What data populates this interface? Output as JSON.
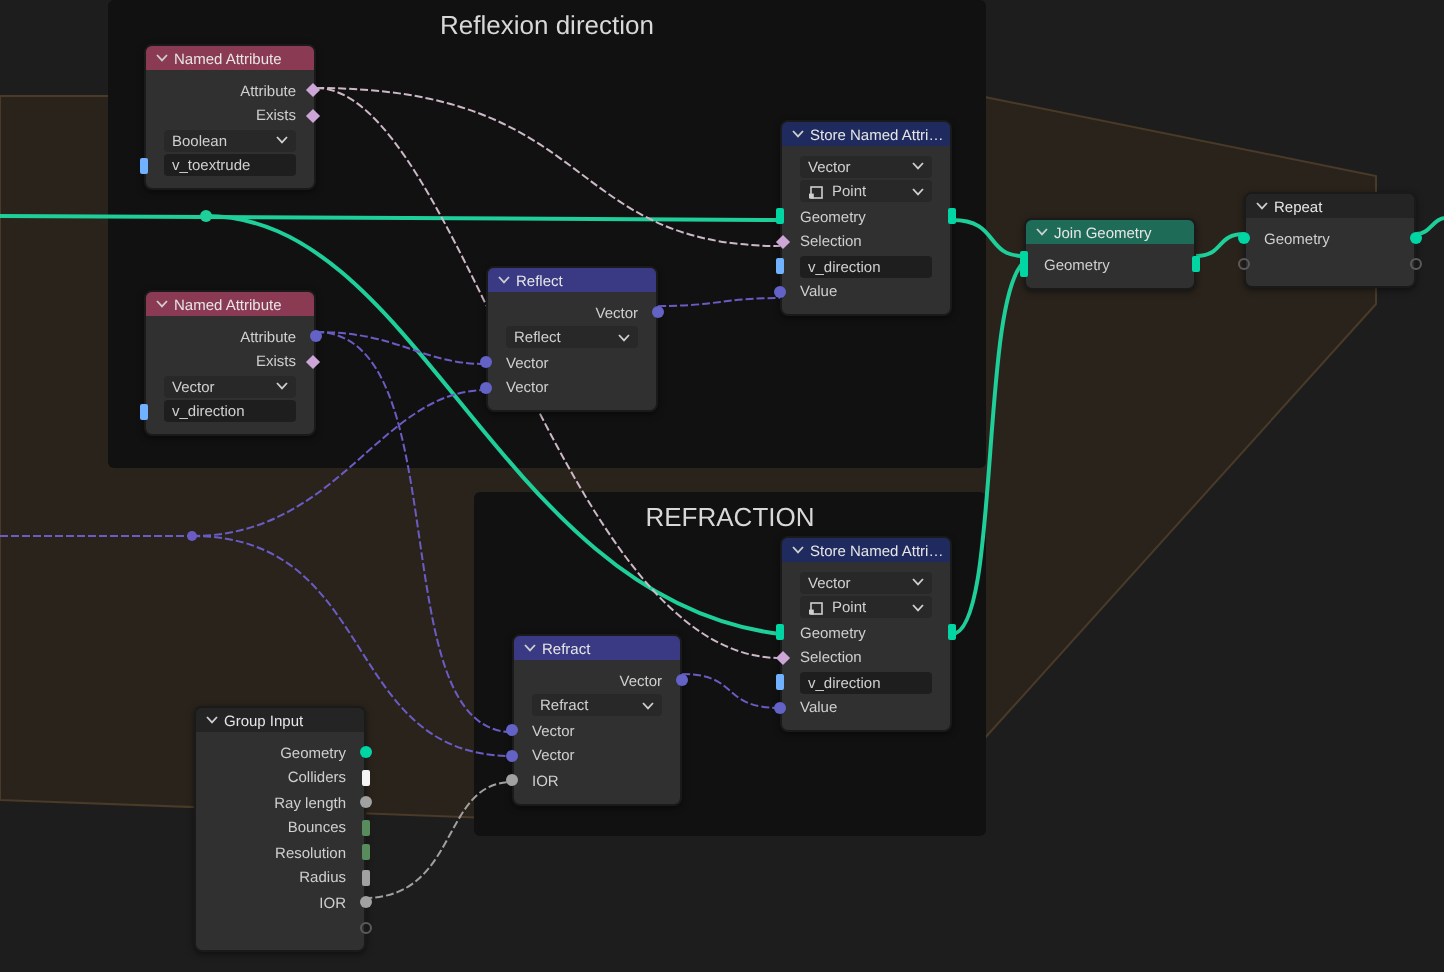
{
  "frames": [
    {
      "label": "Reflexion direction"
    },
    {
      "label": "REFRACTION"
    }
  ],
  "nodes": [
    {
      "title": "Named Attribute",
      "color": "#8b3a53",
      "rows": [
        {
          "kind": "socket",
          "label": "Attribute",
          "out": {
            "kind": "boolean"
          }
        },
        {
          "kind": "socket",
          "label": "Exists",
          "out": {
            "kind": "boolean"
          }
        },
        {
          "kind": "menu",
          "label": "Boolean"
        },
        {
          "kind": "field",
          "value": "v_toextrude",
          "in": {
            "kind": "string"
          }
        }
      ]
    },
    {
      "title": "Store Named Attri…",
      "color": "#1f2a5e",
      "rows": [
        {
          "kind": "menu",
          "label": "Vector"
        },
        {
          "kind": "menu_icon",
          "label": "Point"
        },
        {
          "kind": "socket",
          "label": "Geometry",
          "in": {
            "kind": "geometry"
          },
          "out": {
            "kind": "geometry"
          }
        },
        {
          "kind": "socket",
          "label": "Selection",
          "in": {
            "kind": "boolean"
          }
        },
        {
          "kind": "field",
          "value": "v_direction",
          "in": {
            "kind": "string"
          }
        },
        {
          "kind": "socket",
          "label": "Value",
          "in": {
            "kind": "vector"
          }
        }
      ]
    },
    {
      "title": "Repeat",
      "color": "#242424",
      "rows": [
        {
          "kind": "socket",
          "label": "Geometry",
          "in": {
            "kind": "geometry_dot"
          },
          "out": {
            "kind": "geometry_dot"
          }
        },
        {
          "kind": "socket",
          "in": {
            "kind": "virtual"
          },
          "out": {
            "kind": "virtual"
          }
        }
      ]
    },
    {
      "title": "Join Geometry",
      "color": "#1e6b58",
      "rows": [
        {
          "kind": "socket",
          "label": "Geometry",
          "in": {
            "kind": "geometry_multi"
          },
          "out": {
            "kind": "geometry"
          }
        }
      ]
    },
    {
      "title": "Reflect",
      "color": "#3a3a84",
      "rows": [
        {
          "kind": "socket",
          "label": "Vector",
          "out": {
            "kind": "vector"
          }
        },
        {
          "kind": "menu",
          "label": "Reflect"
        },
        {
          "kind": "socket",
          "label": "Vector",
          "in": {
            "kind": "vector"
          }
        },
        {
          "kind": "socket",
          "label": "Vector",
          "in": {
            "kind": "vector"
          }
        }
      ]
    },
    {
      "title": "Named Attribute",
      "color": "#8b3a53",
      "rows": [
        {
          "kind": "socket",
          "label": "Attribute",
          "out": {
            "kind": "vector"
          }
        },
        {
          "kind": "socket",
          "label": "Exists",
          "out": {
            "kind": "boolean"
          }
        },
        {
          "kind": "menu",
          "label": "Vector"
        },
        {
          "kind": "field",
          "value": "v_direction",
          "in": {
            "kind": "string"
          }
        }
      ]
    },
    {
      "title": "Store Named Attri…",
      "color": "#1f2a5e",
      "rows": [
        {
          "kind": "menu",
          "label": "Vector"
        },
        {
          "kind": "menu_icon",
          "label": "Point"
        },
        {
          "kind": "socket",
          "label": "Geometry",
          "in": {
            "kind": "geometry"
          },
          "out": {
            "kind": "geometry"
          }
        },
        {
          "kind": "socket",
          "label": "Selection",
          "in": {
            "kind": "boolean"
          }
        },
        {
          "kind": "field",
          "value": "v_direction",
          "in": {
            "kind": "string"
          }
        },
        {
          "kind": "socket",
          "label": "Value",
          "in": {
            "kind": "vector"
          }
        }
      ]
    },
    {
      "title": "Refract",
      "color": "#3a3a84",
      "rows": [
        {
          "kind": "socket",
          "label": "Vector",
          "out": {
            "kind": "vector"
          }
        },
        {
          "kind": "menu",
          "label": "Refract"
        },
        {
          "kind": "socket",
          "label": "Vector",
          "in": {
            "kind": "vector"
          }
        },
        {
          "kind": "socket",
          "label": "Vector",
          "in": {
            "kind": "vector"
          }
        },
        {
          "kind": "socket",
          "label": "IOR",
          "in": {
            "kind": "float"
          }
        }
      ]
    },
    {
      "title": "Group Input",
      "color": "#242424",
      "rows": [
        {
          "kind": "socket",
          "label": "Geometry",
          "out": {
            "kind": "geometry_dot"
          }
        },
        {
          "kind": "socket",
          "label": "Colliders",
          "out": {
            "kind": "collection"
          }
        },
        {
          "kind": "socket",
          "label": "Ray length",
          "out": {
            "kind": "float"
          }
        },
        {
          "kind": "socket",
          "label": "Bounces",
          "out": {
            "kind": "int"
          }
        },
        {
          "kind": "socket",
          "label": "Resolution",
          "out": {
            "kind": "int"
          }
        },
        {
          "kind": "socket",
          "label": "Radius",
          "out": {
            "kind": "float_field"
          }
        },
        {
          "kind": "socket",
          "label": "IOR",
          "out": {
            "kind": "float"
          }
        },
        {
          "kind": "socket",
          "out": {
            "kind": "virtual"
          }
        }
      ]
    }
  ]
}
